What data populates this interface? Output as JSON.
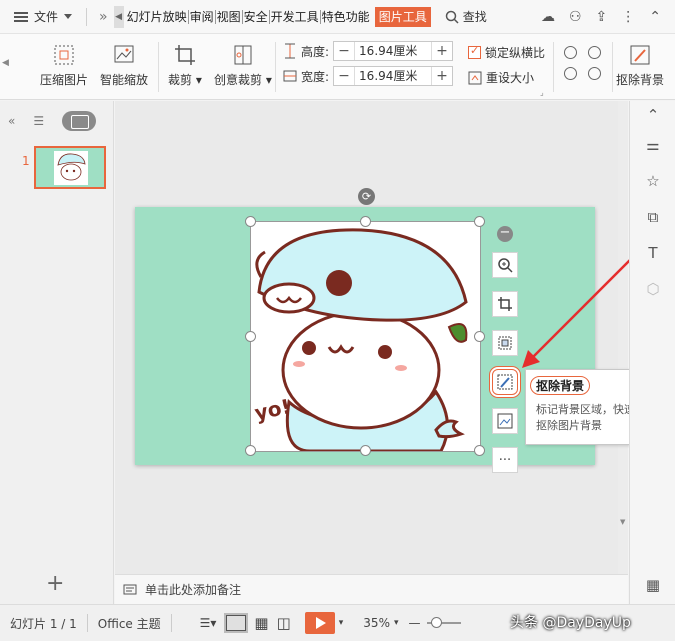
{
  "menubar": {
    "file_label": "文件",
    "tabs": [
      "幻灯片放映",
      "审阅",
      "视图",
      "安全",
      "开发工具",
      "特色功能"
    ],
    "active_tab": "图片工具",
    "search_label": "查找"
  },
  "ribbon": {
    "compress_label": "压缩图片",
    "smart_scale_label": "智能缩放",
    "crop_label": "裁剪",
    "creative_crop_label": "创意裁剪",
    "height_label": "高度:",
    "height_value": "16.94厘米",
    "width_label": "宽度:",
    "width_value": "16.94厘米",
    "lock_ratio_label": "锁定纵横比",
    "reset_size_label": "重设大小",
    "remove_bg_label": "抠除背景"
  },
  "left_panel": {
    "slide_number": "1"
  },
  "picture": {
    "text": "yo!"
  },
  "tooltip": {
    "title": "抠除背景",
    "description": "标记背景区域，快速智能抠除图片背景"
  },
  "notes": {
    "placeholder": "单击此处添加备注"
  },
  "statusbar": {
    "slide_info": "幻灯片 1 / 1",
    "theme": "Office 主题",
    "zoom": "35%",
    "zoom_minus": "—",
    "watermark": "头条 @DayDayUp"
  },
  "colors": {
    "accent": "#e8663d",
    "slide_bg": "#9fdfc4"
  }
}
